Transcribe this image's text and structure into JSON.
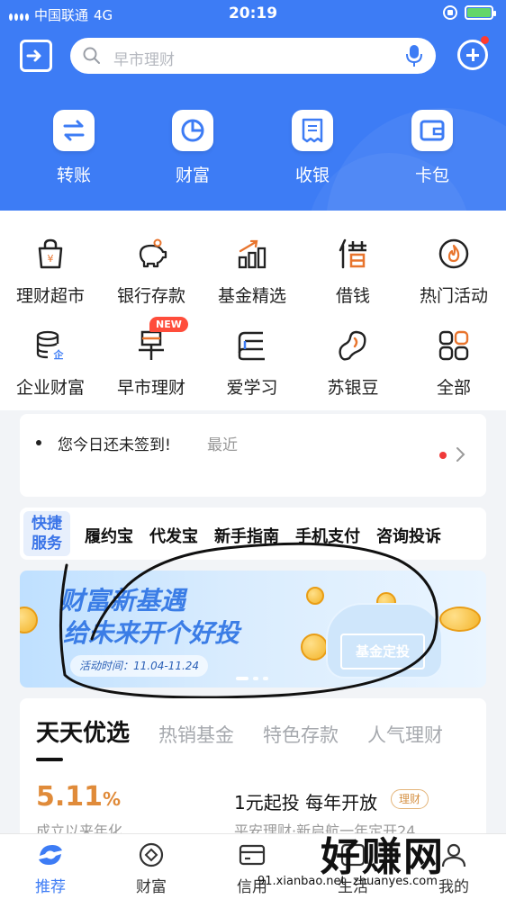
{
  "status_bar": {
    "carrier": "中国联通",
    "network": "4G",
    "time": "20:19"
  },
  "search": {
    "placeholder": "早市理财"
  },
  "quick_actions": [
    {
      "label": "转账",
      "icon": "transfer-icon"
    },
    {
      "label": "财富",
      "icon": "pie-chart-icon"
    },
    {
      "label": "收银",
      "icon": "receipt-icon"
    },
    {
      "label": "卡包",
      "icon": "wallet-icon"
    }
  ],
  "grid": [
    {
      "label": "理财超市",
      "icon": "shopping-bag-icon"
    },
    {
      "label": "银行存款",
      "icon": "piggy-bank-icon"
    },
    {
      "label": "基金精选",
      "icon": "bar-chart-icon"
    },
    {
      "label": "借钱",
      "icon": "borrow-icon"
    },
    {
      "label": "热门活动",
      "icon": "flame-icon"
    },
    {
      "label": "企业财富",
      "icon": "database-icon"
    },
    {
      "label": "早市理财",
      "icon": "morning-icon"
    },
    {
      "label": "爱学习",
      "icon": "book-icon"
    },
    {
      "label": "苏银豆",
      "icon": "bean-icon"
    },
    {
      "label": "全部",
      "icon": "apps-icon"
    }
  ],
  "new_badge": "NEW",
  "sign_in": {
    "text": "您今日还未签到!",
    "recent": "最近"
  },
  "service": {
    "tag": "快捷服务",
    "items": [
      "履约宝",
      "代发宝",
      "新手指南",
      "手机支付",
      "咨询投诉"
    ]
  },
  "banner": {
    "title_line1": "财富新基遇",
    "title_line2": "给未来开个好投",
    "date": "活动时间：11.04-11.24",
    "card_label": "基金定投"
  },
  "products": {
    "tabs": [
      "天天优选",
      "热销基金",
      "特色存款",
      "人气理财"
    ],
    "rate": "5.11",
    "rate_unit": "%",
    "rate_label": "成立以来年化",
    "title": "1元起投 每年开放",
    "tag": "理财",
    "subtitle": "平安理财·新启航一年定开24"
  },
  "bottom_nav": [
    {
      "label": "推荐",
      "icon": "home-icon",
      "active": true
    },
    {
      "label": "财富",
      "icon": "wealth-icon",
      "active": false
    },
    {
      "label": "信用",
      "icon": "card-icon",
      "active": false
    },
    {
      "label": "生活",
      "icon": "life-icon",
      "active": false
    },
    {
      "label": "我的",
      "icon": "user-icon",
      "active": false
    }
  ],
  "watermark": {
    "brand": "好赚网",
    "url": "91.xianbao.net",
    "url2": "zhuanyes.com"
  },
  "colors": {
    "brand_blue": "#3d7cf5",
    "rate_orange": "#e08b3a",
    "badge_red": "#ff4d3b"
  }
}
